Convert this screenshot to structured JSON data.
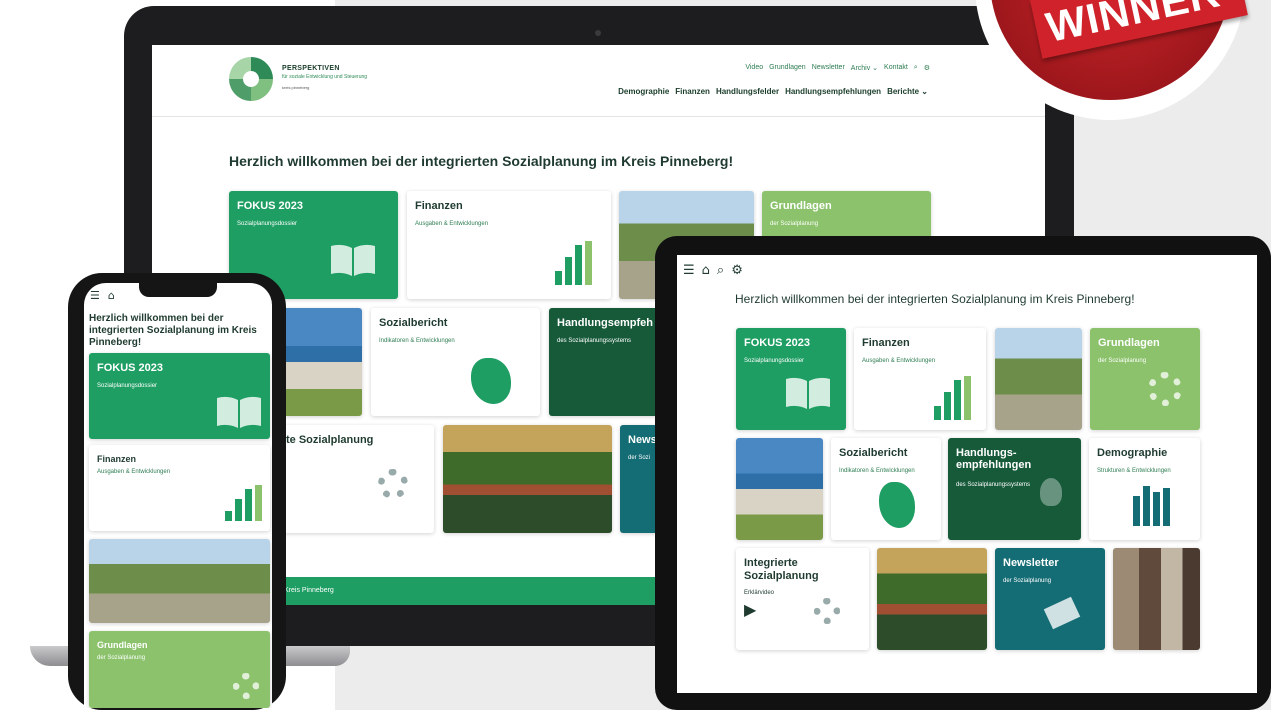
{
  "badge": {
    "text": "WINNER"
  },
  "laptop": {
    "brand": {
      "name": "PERSPEKTIVEN",
      "tagline": "für soziale Entwicklung und Steuerung",
      "kreis": "kreis pinneberg"
    },
    "top_nav": [
      "Video",
      "Grundlagen",
      "Newsletter",
      "Archiv ⌄",
      "Kontakt"
    ],
    "main_nav": [
      "Demographie",
      "Finanzen",
      "Handlungsfelder",
      "Handlungsempfehlungen",
      "Berichte ⌄"
    ],
    "welcome": "Herzlich willkommen bei der integrierten Sozialplanung im Kreis Pinneberg!",
    "tiles": {
      "fokus": {
        "title": "FOKUS 2023",
        "sub": "Sozialplanungsdossier"
      },
      "finanzen": {
        "title": "Finanzen",
        "sub": "Ausgaben & Entwicklungen"
      },
      "grundlagen": {
        "title": "Grundlagen",
        "sub": "der Sozialplanung"
      },
      "sozialbericht": {
        "title": "Sozialbericht",
        "sub": "Indikatoren & Entwicklungen"
      },
      "handlung": {
        "title": "Handlungsempfeh",
        "sub": "des Sozialplanungssystems"
      },
      "integriert": {
        "title": "te Sozialplanung"
      },
      "news": {
        "title": "News",
        "sub": "der Sozi"
      }
    },
    "footer": "Kreis Pinneberg"
  },
  "tablet": {
    "welcome": "Herzlich willkommen bei der integrierten Sozialplanung im Kreis Pinneberg!",
    "tiles": {
      "fokus": {
        "title": "FOKUS 2023",
        "sub": "Sozialplanungsdossier"
      },
      "finanzen": {
        "title": "Finanzen",
        "sub": "Ausgaben & Entwicklungen"
      },
      "grundlagen": {
        "title": "Grundlagen",
        "sub": "der Sozialplanung"
      },
      "sozialbericht": {
        "title": "Sozialbericht",
        "sub": "Indikatoren & Entwicklungen"
      },
      "handlung": {
        "title1": "Handlungs-",
        "title2": "empfehlungen",
        "sub": "des Sozialplanungssystems"
      },
      "demographie": {
        "title": "Demographie",
        "sub": "Strukturen & Entwicklungen"
      },
      "integriert": {
        "title1": "Integrierte",
        "title2": "Sozialplanung",
        "sub": "Erklärvideo"
      },
      "newsletter": {
        "title": "Newsletter",
        "sub": "der Sozialplanung"
      }
    }
  },
  "phone": {
    "welcome": "Herzlich willkommen bei der integrierten Sozialplanung im Kreis Pinneberg!",
    "tiles": {
      "fokus": {
        "title": "FOKUS 2023",
        "sub": "Sozialplanungsdossier"
      },
      "finanzen": {
        "title": "Finanzen",
        "sub": "Ausgaben & Entwicklungen"
      },
      "grundlagen": {
        "title": "Grundlagen",
        "sub": "der Sozialplanung"
      }
    }
  },
  "colors": {
    "primary": "#1e9e63",
    "light": "#8bc26b",
    "dark": "#175a3a",
    "teal": "#146c74",
    "badge": "#d0222a"
  },
  "icons": [
    "book-icon",
    "bar-chart-icon",
    "gear-icon",
    "map-icon",
    "lightbulb-icon",
    "play-icon",
    "menu-icon",
    "home-icon",
    "search-icon",
    "settings-icon"
  ]
}
